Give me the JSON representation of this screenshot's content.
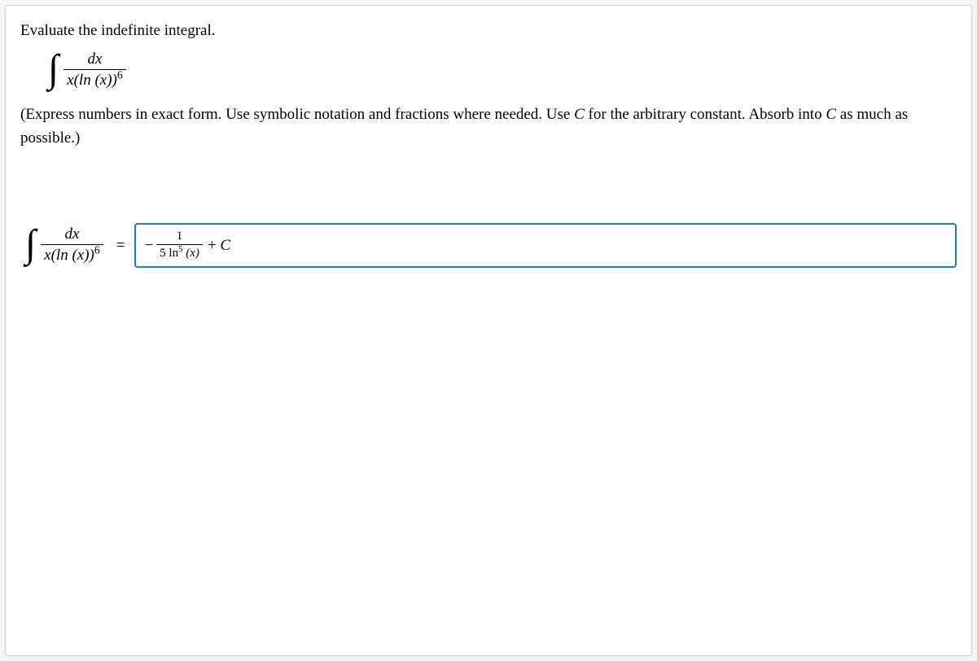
{
  "prompt": "Evaluate the indefinite integral.",
  "integral": {
    "num": "dx",
    "den_pre": "x(ln (x))",
    "den_exp": "6"
  },
  "note_parts": {
    "a": "(Express numbers in exact form. Use symbolic notation and fractions where needed. Use ",
    "c1": "C",
    "b": " for the arbitrary constant. Absorb into ",
    "c2": "C",
    "d": " as much as possible.)"
  },
  "answer": {
    "lhs_num": "dx",
    "lhs_den_pre": "x(ln (x))",
    "lhs_den_exp": "6",
    "eq": "=",
    "minus": "−",
    "rhs_num": "1",
    "rhs_den_pre": "5 ln",
    "rhs_den_exp": "5",
    "rhs_den_post": " (x)",
    "plus_c": "+ C"
  }
}
